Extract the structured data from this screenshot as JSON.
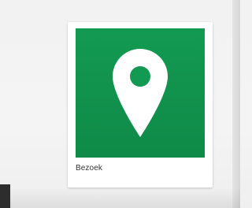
{
  "tile": {
    "label": "Bezoek",
    "icon": "map-pin-icon",
    "color": "#139a52"
  }
}
